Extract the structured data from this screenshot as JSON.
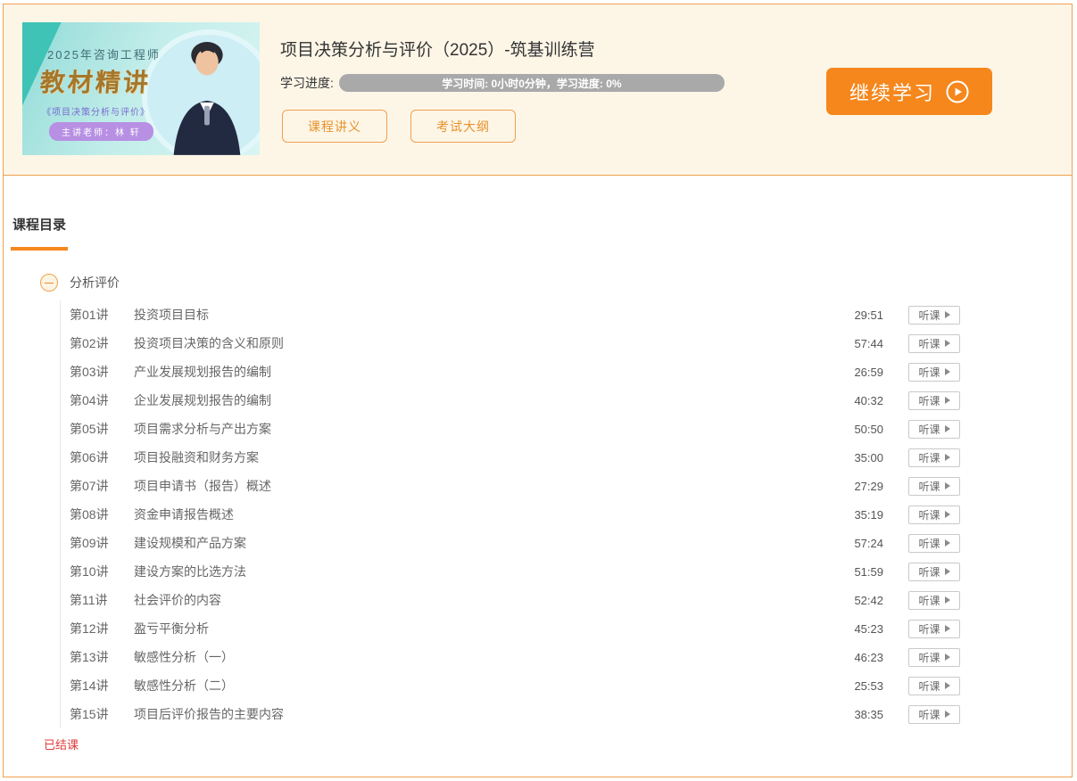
{
  "header": {
    "thumbnail": {
      "year_line": "2025年咨询工程师",
      "main_title": "教材精讲",
      "subtitle": "《项目决策分析与评价》",
      "teacher_badge": "主讲老师：林 轩"
    },
    "course_title": "项目决策分析与评价（2025）-筑基训练营",
    "progress_label": "学习进度:",
    "progress_text": "学习时间: 0小时0分钟，学习进度: 0%",
    "progress_percent": "0%",
    "handout_button": "课程讲义",
    "syllabus_button": "考试大纲",
    "continue_button": "继续学习"
  },
  "catalog": {
    "tab_label": "课程目录",
    "section_title": "分析评价",
    "listen_button": "听课",
    "footer_status": "已结课",
    "lectures": [
      {
        "no": "第01讲",
        "title": "投资项目目标",
        "duration": "29:51"
      },
      {
        "no": "第02讲",
        "title": "投资项目决策的含义和原则",
        "duration": "57:44"
      },
      {
        "no": "第03讲",
        "title": "产业发展规划报告的编制",
        "duration": "26:59"
      },
      {
        "no": "第04讲",
        "title": "企业发展规划报告的编制",
        "duration": "40:32"
      },
      {
        "no": "第05讲",
        "title": "项目需求分析与产出方案",
        "duration": "50:50"
      },
      {
        "no": "第06讲",
        "title": "项目投融资和财务方案",
        "duration": "35:00"
      },
      {
        "no": "第07讲",
        "title": "项目申请书（报告）概述",
        "duration": "27:29"
      },
      {
        "no": "第08讲",
        "title": "资金申请报告概述",
        "duration": "35:19"
      },
      {
        "no": "第09讲",
        "title": "建设规模和产品方案",
        "duration": "57:24"
      },
      {
        "no": "第10讲",
        "title": "建设方案的比选方法",
        "duration": "51:59"
      },
      {
        "no": "第11讲",
        "title": "社会评价的内容",
        "duration": "52:42"
      },
      {
        "no": "第12讲",
        "title": "盈亏平衡分析",
        "duration": "45:23"
      },
      {
        "no": "第13讲",
        "title": "敏感性分析（一）",
        "duration": "46:23"
      },
      {
        "no": "第14讲",
        "title": "敏感性分析（二）",
        "duration": "25:53"
      },
      {
        "no": "第15讲",
        "title": "项目后评价报告的主要内容",
        "duration": "38:35"
      }
    ]
  },
  "colors": {
    "accent_orange": "#f5871c",
    "border_orange": "#f0a04d",
    "header_bg": "#fdf6e7",
    "progress_gray": "#a9a9a9",
    "status_red": "#e03b3b"
  }
}
